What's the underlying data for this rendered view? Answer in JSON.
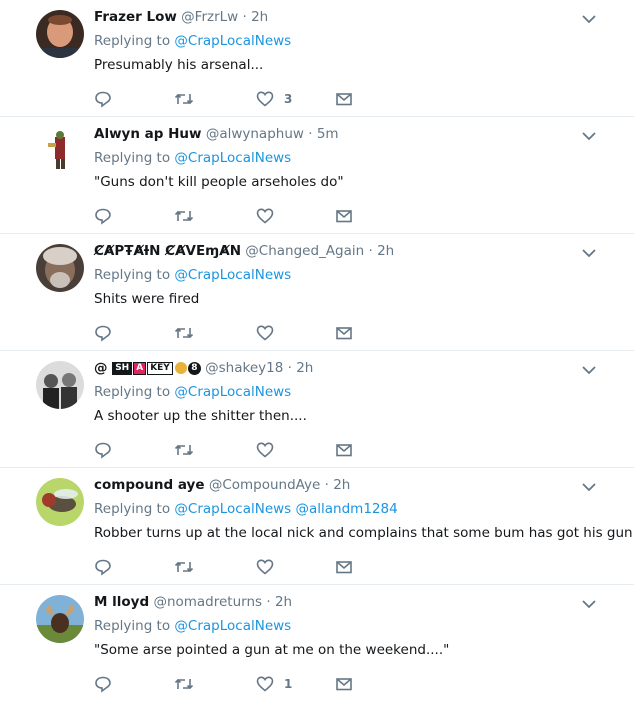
{
  "tweets": [
    {
      "name": "Frazer Low",
      "handle": "@FrzrLw",
      "time": "2h",
      "replying_prefix": "Replying to",
      "replying_to": "@CrapLocalNews",
      "replying_to_2": "",
      "text": "Presumably his arsenal...",
      "like_count": "3"
    },
    {
      "name": "Alwyn ap Huw",
      "handle": "@alwynaphuw",
      "time": "5m",
      "replying_prefix": "Replying to",
      "replying_to": "@CrapLocalNews",
      "replying_to_2": "",
      "text": "\"Guns don't kill people arseholes do\"",
      "like_count": ""
    },
    {
      "name": "ȻȺPŦȺƗN ȻȺVEɱȺN",
      "handle": "@Changed_Again",
      "time": "2h",
      "replying_prefix": "Replying to",
      "replying_to": "@CrapLocalNews",
      "replying_to_2": "",
      "text": "Shits were fired",
      "like_count": ""
    },
    {
      "name": "@",
      "name_badges": [
        "SH",
        "A",
        "KEY"
      ],
      "name_badge_8": "8",
      "handle": "@shakey18",
      "time": "2h",
      "replying_prefix": "Replying to",
      "replying_to": "@CrapLocalNews",
      "replying_to_2": "",
      "text": "A shooter up the shitter then....",
      "like_count": ""
    },
    {
      "name": "compound aye",
      "handle": "@CompoundAye",
      "time": "2h",
      "replying_prefix": "Replying to",
      "replying_to": "@CrapLocalNews",
      "replying_to_2": "@allandm1284",
      "text": "Robber turns up at the local nick and complains that some bum has got his gun.",
      "like_count": ""
    },
    {
      "name": "M lloyd",
      "handle": "@nomadreturns",
      "time": "2h",
      "replying_prefix": "Replying to",
      "replying_to": "@CrapLocalNews",
      "replying_to_2": "",
      "text": "\"Some arse pointed a gun at me on  the weekend....\"",
      "like_count": "1"
    }
  ],
  "icons": {
    "reply": "reply-icon",
    "retweet": "retweet-icon",
    "like": "like-icon",
    "dm": "direct-message-icon",
    "menu": "chevron-down-icon"
  },
  "colors": {
    "link": "#1b95e0",
    "muted": "#657786",
    "text": "#14171a",
    "divider": "#e6ecf0"
  }
}
